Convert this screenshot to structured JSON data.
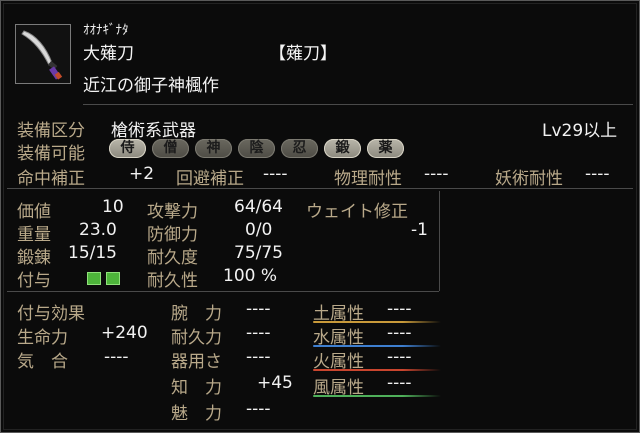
{
  "item": {
    "reading": "ｵｵﾅｷﾞﾅﾀ",
    "name": "大薙刀",
    "category": "【薙刀】",
    "maker": "近江の御子神楓作"
  },
  "equip": {
    "class_label": "装備区分",
    "class_value": "槍術系武器",
    "level_req": "Lv29以上",
    "usable_label": "装備可能",
    "classes": [
      {
        "char": "侍",
        "active": true
      },
      {
        "char": "僧",
        "active": false
      },
      {
        "char": "神",
        "active": false
      },
      {
        "char": "陰",
        "active": false
      },
      {
        "char": "忍",
        "active": false
      },
      {
        "char": "鍛",
        "active": true
      },
      {
        "char": "薬",
        "active": true
      }
    ]
  },
  "modifiers": [
    {
      "label": "命中補正",
      "value": "+2"
    },
    {
      "label": "回避補正",
      "value": "----"
    },
    {
      "label": "物理耐性",
      "value": "----"
    },
    {
      "label": "妖術耐性",
      "value": "----"
    }
  ],
  "stats_left": [
    {
      "label": "価値",
      "value": "10"
    },
    {
      "label": "重量",
      "value": "23.0"
    },
    {
      "label": "鍛錬",
      "value": "15/15"
    },
    {
      "label": "付与",
      "value": "",
      "slots": 2
    }
  ],
  "stats_mid": [
    {
      "label": "攻撃力",
      "value": "64/64"
    },
    {
      "label": "防御力",
      "value": "0/0"
    },
    {
      "label": "耐久度",
      "value": "75/75"
    },
    {
      "label": "耐久性",
      "value": "100 %"
    }
  ],
  "weight_mod": {
    "label": "ウェイト修正",
    "value": "-1"
  },
  "effects": {
    "title": "付与効果",
    "left": [
      {
        "label": "生命力",
        "value": "+240"
      },
      {
        "label": "気　合",
        "value": "----"
      }
    ],
    "mid": [
      {
        "label": "腕　力",
        "value": "----"
      },
      {
        "label": "耐久力",
        "value": "----"
      },
      {
        "label": "器用さ",
        "value": "----"
      },
      {
        "label": "知　力",
        "value": "+45"
      },
      {
        "label": "魅　力",
        "value": "----"
      }
    ],
    "elements": [
      {
        "label": "土属性",
        "value": "----",
        "color": "#c99a3a"
      },
      {
        "label": "水属性",
        "value": "----",
        "color": "#3e7fd0"
      },
      {
        "label": "火属性",
        "value": "----",
        "color": "#c9452e"
      },
      {
        "label": "風属性",
        "value": "----",
        "color": "#4fb05a"
      }
    ]
  }
}
